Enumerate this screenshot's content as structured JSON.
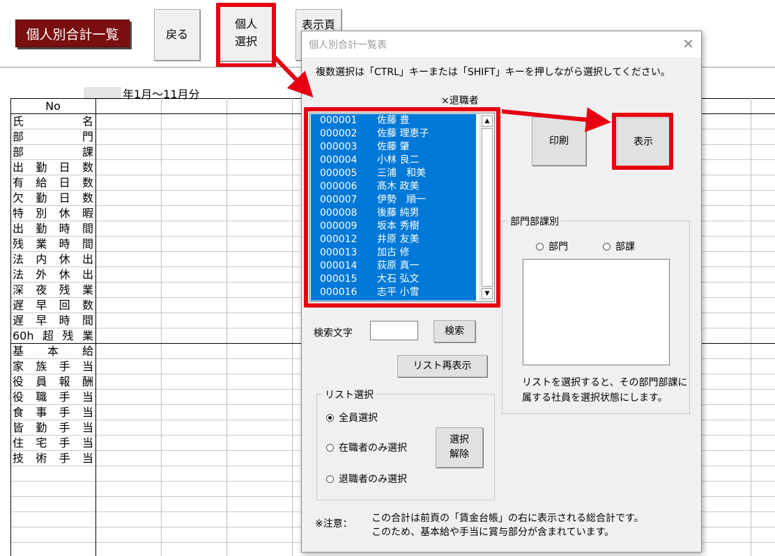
{
  "sheet": {
    "title": "個人別合計一覧",
    "back_button": "戻る",
    "select_button_line1": "個人",
    "select_button_line2": "選択",
    "page_button": "表示頁",
    "period": "年1月～11月分",
    "rows": [
      "No",
      "氏名",
      "部門",
      "部課",
      "出勤日数",
      "有給日数",
      "欠勤日数",
      "特別休暇",
      "出勤時間",
      "残業時間",
      "法内休出",
      "法外休出",
      "深夜残業",
      "遅早回数",
      "遅早時間",
      "60h超残業",
      "基本給",
      "家族手当",
      "役員報酬",
      "役職手当",
      "食事手当",
      "皆勤手当",
      "住宅手当",
      "技術手当"
    ]
  },
  "dialog": {
    "title": "個人別合計一覧表",
    "close_icon": "close-icon",
    "instruction": "複数選択は「CTRL」キーまたは「SHIFT」キーを押しながら選択してください。",
    "retired_label": "×退職者",
    "employees": [
      {
        "code": "000001",
        "name": "佐藤 豊"
      },
      {
        "code": "000002",
        "name": "佐藤 理恵子"
      },
      {
        "code": "000003",
        "name": "佐藤 肇"
      },
      {
        "code": "000004",
        "name": "小林 良二"
      },
      {
        "code": "000005",
        "name": "三浦　和美"
      },
      {
        "code": "000006",
        "name": "髙木 政美"
      },
      {
        "code": "000007",
        "name": "伊勢　順一"
      },
      {
        "code": "000008",
        "name": "後藤 純男"
      },
      {
        "code": "000009",
        "name": "坂本 秀樹"
      },
      {
        "code": "000012",
        "name": "井原 友美"
      },
      {
        "code": "000013",
        "name": "加古 修"
      },
      {
        "code": "000014",
        "name": "荻原 真一"
      },
      {
        "code": "000015",
        "name": "大石 弘文"
      },
      {
        "code": "000016",
        "name": "志平 小雪"
      }
    ],
    "print_button": "印刷",
    "show_button": "表示",
    "search_label": "検索文字",
    "search_value": "",
    "search_button": "検索",
    "relist_button": "リスト再表示",
    "list_select": {
      "legend": "リスト選択",
      "all": "全員選択",
      "active": "在職者のみ選択",
      "retired": "退職者のみ選択",
      "deselect_line1": "選択",
      "deselect_line2": "解除"
    },
    "dept": {
      "legend": "部門部課別",
      "dept_option": "部門",
      "section_option": "部課",
      "note_line1": "リストを選択すると、その部門部課に",
      "note_line2": "属する社員を選択状態にします。"
    },
    "notice_label": "※注意：",
    "notice_line1": "この合計は前頁の「賃金台帳」の右に表示される総合計です。",
    "notice_line2": "このため、基本給や手当に賞与部分が含まれています。"
  },
  "colors": {
    "highlight": "#e60012",
    "selection": "#0078d7",
    "title_bg": "#7b0e10"
  }
}
